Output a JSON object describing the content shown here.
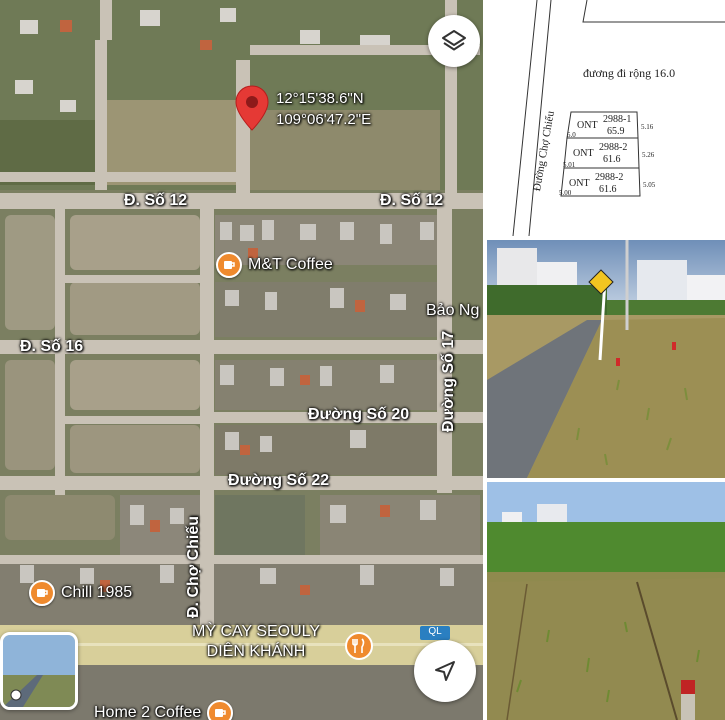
{
  "map": {
    "coordinates": {
      "lat": "12°15'38.6\"N",
      "lng": "109°06'47.2\"E"
    },
    "streets": {
      "so12_left": "Đ. Số 12",
      "so12_right": "Đ. Số 12",
      "so16": "Đ. Số 16",
      "so17": "Đường Số 17",
      "so20": "Đường Số 20",
      "so22": "Đường Số 22",
      "cho_chieu": "Đ. Chợ Chiếu",
      "bao_ng": "Bảo Ng"
    },
    "pois": {
      "mt_coffee": "M&T Coffee",
      "chill": "Chill 1985",
      "mycay_line1": "MỲ CAY SEOULY",
      "mycay_line2": "DIÊN KHÁNH",
      "home2": "Home 2 Coffee",
      "badge": "QL"
    },
    "icons": {
      "pin": "location-pin-icon",
      "layers": "layers-icon",
      "navigate": "navigation-arrow-icon",
      "coffee": "coffee-cup-icon",
      "restaurant": "fork-knife-icon"
    },
    "colors": {
      "pin": "#e53935",
      "poi": "#ef8a2e",
      "road": "#c9c2b6"
    }
  },
  "survey": {
    "road_width": "đương đi rộng 16.0",
    "road_name": "Đường Chợ Chiếu",
    "lots": [
      {
        "type": "ONT",
        "id": "2988-1",
        "area": "65.9"
      },
      {
        "type": "ONT",
        "id": "2988-2",
        "area": "61.6"
      },
      {
        "type": "ONT",
        "id": "2988-2",
        "area": "61.6"
      }
    ],
    "dims": [
      "5.0",
      "5.01",
      "5.00",
      "5.16",
      "5.26",
      "5.05"
    ]
  }
}
